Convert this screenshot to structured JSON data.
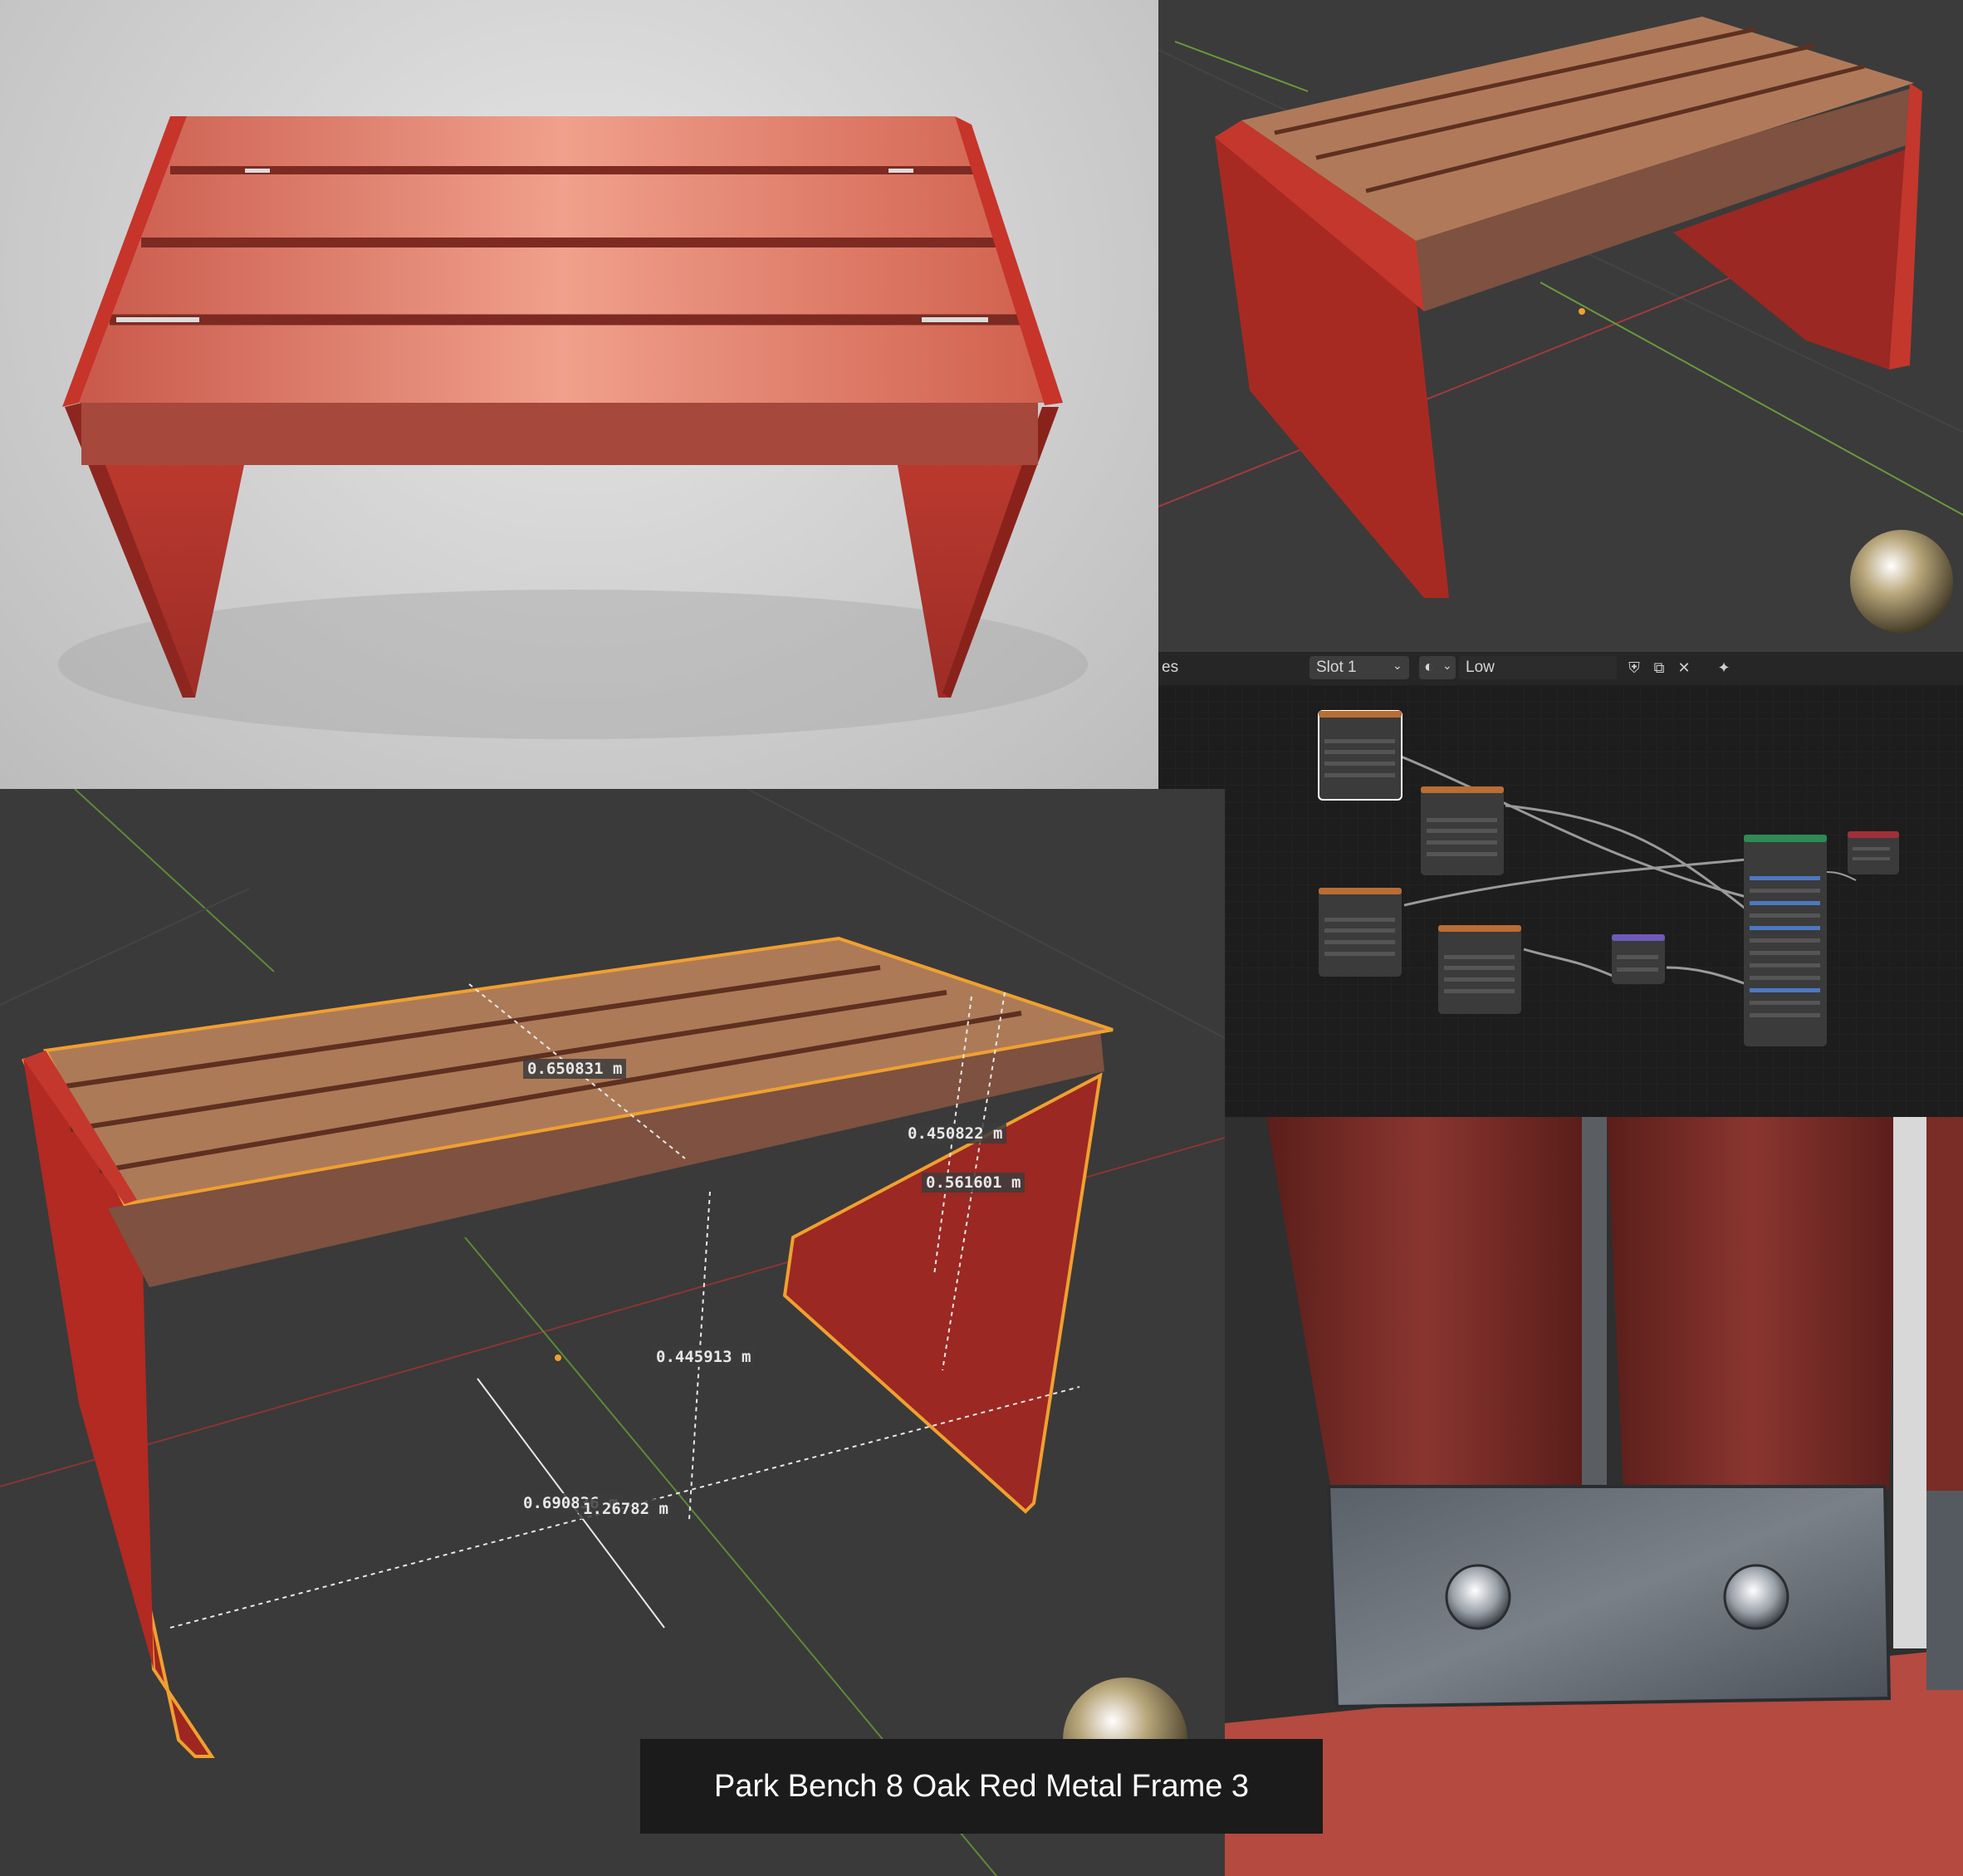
{
  "caption": "Park Bench 8 Oak Red Metal Frame 3",
  "material_header": {
    "tab_fragment": "es",
    "slot": "Slot 1",
    "material_name": "Low"
  },
  "measurements": {
    "depth_seat": "0.650831 m",
    "height_a": "0.450822 m",
    "height_b": "0.561601 m",
    "height_c": "0.445913 m",
    "depth_base": "0.690836 m",
    "length": "1.26782 m"
  },
  "icons": [
    "material-sphere-icon",
    "shield-icon",
    "copy-icon",
    "close-icon",
    "pin-icon",
    "chevron-down-icon"
  ],
  "colors": {
    "frame_red": "#b22a22",
    "wood": "#b07a5a",
    "selection_orange": "#f0a030",
    "viewport_bg": "#3a3a3a",
    "node_editor_bg": "#1d1d1d"
  }
}
